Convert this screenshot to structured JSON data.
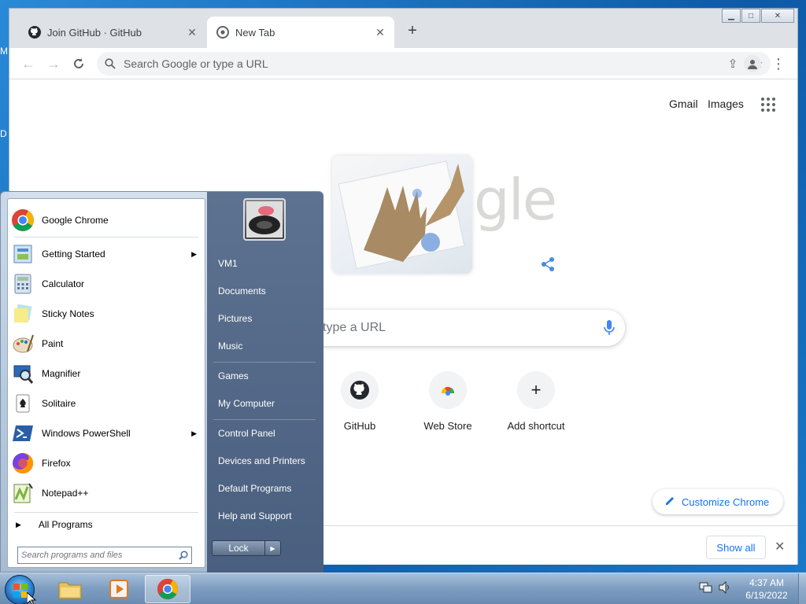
{
  "desktop": {
    "icon_text_1": "M",
    "icon_text_2": "D"
  },
  "browser": {
    "tabs": [
      {
        "title": "Join GitHub · GitHub"
      },
      {
        "title": "New Tab"
      }
    ],
    "new_tab_symbol": "+",
    "close_symbol": "✕",
    "omnibox_placeholder": "Search Google or type a URL",
    "ntp": {
      "gmail": "Gmail",
      "images": "Images",
      "doodle_text": "gle",
      "search_placeholder": "type a URL",
      "shortcuts": [
        {
          "label": "GitHub"
        },
        {
          "label": "Web Store"
        },
        {
          "label": "Add shortcut",
          "symbol": "+"
        }
      ],
      "customize": "Customize Chrome"
    },
    "download_bar": {
      "show_all": "Show all"
    }
  },
  "start_menu": {
    "programs": [
      {
        "label": "Google Chrome",
        "icon": "chrome-icon"
      },
      {
        "label": "Getting Started",
        "icon": "getting-started-icon",
        "has_submenu": true
      },
      {
        "label": "Calculator",
        "icon": "calculator-icon"
      },
      {
        "label": "Sticky Notes",
        "icon": "sticky-notes-icon"
      },
      {
        "label": "Paint",
        "icon": "paint-icon"
      },
      {
        "label": "Magnifier",
        "icon": "magnifier-icon"
      },
      {
        "label": "Solitaire",
        "icon": "solitaire-icon"
      },
      {
        "label": "Windows PowerShell",
        "icon": "powershell-icon",
        "has_submenu": true
      },
      {
        "label": "Firefox",
        "icon": "firefox-icon"
      },
      {
        "label": "Notepad++",
        "icon": "notepadpp-icon"
      }
    ],
    "all_programs": "All Programs",
    "search_placeholder": "Search programs and files",
    "right_links": [
      "VM1",
      "Documents",
      "Pictures",
      "Music",
      "Games",
      "My Computer",
      "Control Panel",
      "Devices and Printers",
      "Default Programs",
      "Help and Support"
    ],
    "lock": "Lock"
  },
  "taskbar": {
    "clock_time": "4:37 AM",
    "clock_date": "6/19/2022"
  },
  "colors": {
    "accent": "#1a73e8",
    "taskbar": "#7d9dc0",
    "start_right": "#4a5f7f"
  }
}
